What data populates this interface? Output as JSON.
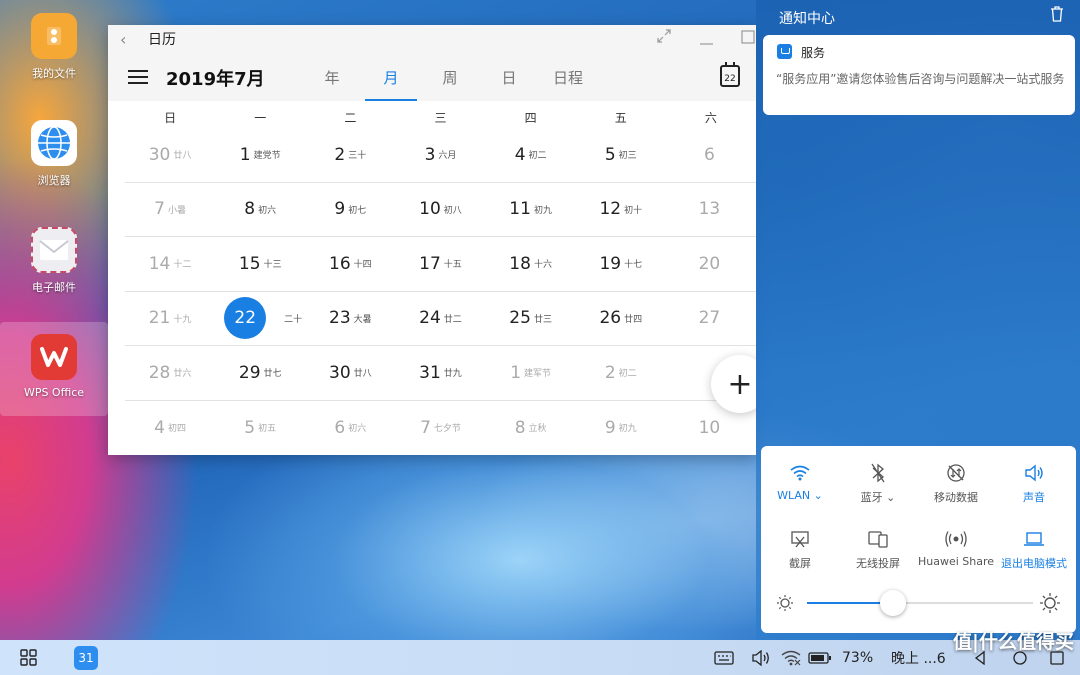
{
  "desktop": {
    "icons": [
      {
        "label": "我的文件",
        "color": "#f5a833"
      },
      {
        "label": "浏览器",
        "color": "#2d8ef0"
      },
      {
        "label": "电子邮件",
        "color": "#e9e9ee"
      },
      {
        "label": "WPS Office",
        "color": "#e23b35"
      }
    ]
  },
  "calendar": {
    "title": "日历",
    "month_label": "2019年7月",
    "view_tabs": [
      "年",
      "月",
      "周",
      "日",
      "日程"
    ],
    "active_view": "月",
    "today_button": "22",
    "weekdays": [
      "日",
      "一",
      "二",
      "三",
      "四",
      "五",
      "六"
    ],
    "weeks": [
      [
        {
          "d": "30",
          "l": "廿八",
          "o": true
        },
        {
          "d": "1",
          "l": "建党节"
        },
        {
          "d": "2",
          "l": "三十"
        },
        {
          "d": "3",
          "l": "六月"
        },
        {
          "d": "4",
          "l": "初二"
        },
        {
          "d": "5",
          "l": "初三"
        },
        {
          "d": "6",
          "l": "",
          "o": true
        }
      ],
      [
        {
          "d": "7",
          "l": "小暑",
          "o": true
        },
        {
          "d": "8",
          "l": "初六"
        },
        {
          "d": "9",
          "l": "初七"
        },
        {
          "d": "10",
          "l": "初八"
        },
        {
          "d": "11",
          "l": "初九"
        },
        {
          "d": "12",
          "l": "初十"
        },
        {
          "d": "13",
          "l": "",
          "o": true
        }
      ],
      [
        {
          "d": "14",
          "l": "十二",
          "o": true
        },
        {
          "d": "15",
          "l": "十三"
        },
        {
          "d": "16",
          "l": "十四"
        },
        {
          "d": "17",
          "l": "十五"
        },
        {
          "d": "18",
          "l": "十六"
        },
        {
          "d": "19",
          "l": "十七"
        },
        {
          "d": "20",
          "l": "",
          "o": true
        }
      ],
      [
        {
          "d": "21",
          "l": "十九",
          "o": true
        },
        {
          "d": "22",
          "l": "二十",
          "today": true
        },
        {
          "d": "23",
          "l": "大暑"
        },
        {
          "d": "24",
          "l": "廿二"
        },
        {
          "d": "25",
          "l": "廿三"
        },
        {
          "d": "26",
          "l": "廿四"
        },
        {
          "d": "27",
          "l": "",
          "o": true
        }
      ],
      [
        {
          "d": "28",
          "l": "廿六",
          "o": true
        },
        {
          "d": "29",
          "l": "廿七"
        },
        {
          "d": "30",
          "l": "廿八"
        },
        {
          "d": "31",
          "l": "廿九"
        },
        {
          "d": "1",
          "l": "建军节",
          "o": true
        },
        {
          "d": "2",
          "l": "初二",
          "o": true
        },
        {
          "d": "",
          "l": "",
          "o": true
        }
      ],
      [
        {
          "d": "4",
          "l": "初四",
          "o": true
        },
        {
          "d": "5",
          "l": "初五",
          "o": true
        },
        {
          "d": "6",
          "l": "初六",
          "o": true
        },
        {
          "d": "7",
          "l": "七夕节",
          "o": true
        },
        {
          "d": "8",
          "l": "立秋",
          "o": true
        },
        {
          "d": "9",
          "l": "初九",
          "o": true
        },
        {
          "d": "10",
          "l": "",
          "o": true
        }
      ]
    ],
    "fab_label": "+"
  },
  "notification_center": {
    "title": "通知中心",
    "card": {
      "app_name": "服务",
      "message": "“服务应用”邀请您体验售后咨询与问题解决一站式服务"
    },
    "quick_settings": [
      {
        "label": "WLAN",
        "on": true,
        "icon": "wifi-icon",
        "dropdown": true
      },
      {
        "label": "蓝牙",
        "on": false,
        "icon": "bluetooth-off-icon",
        "dropdown": true
      },
      {
        "label": "移动数据",
        "on": false,
        "icon": "mobile-data-off-icon"
      },
      {
        "label": "声音",
        "on": true,
        "icon": "sound-icon"
      },
      {
        "label": "截屏",
        "on": false,
        "icon": "screenshot-icon"
      },
      {
        "label": "无线投屏",
        "on": false,
        "icon": "wireless-projection-icon"
      },
      {
        "label": "Huawei Share",
        "on": false,
        "icon": "huawei-share-icon"
      },
      {
        "label": "退出电脑模式",
        "on": true,
        "icon": "laptop-icon"
      }
    ],
    "brightness": 0.38
  },
  "taskbar": {
    "calendar_app_day": "31",
    "battery": "73%",
    "time_partial": "晚上 ...6"
  },
  "watermark": "值|什么值得买",
  "accent_color": "#1a7fe3"
}
